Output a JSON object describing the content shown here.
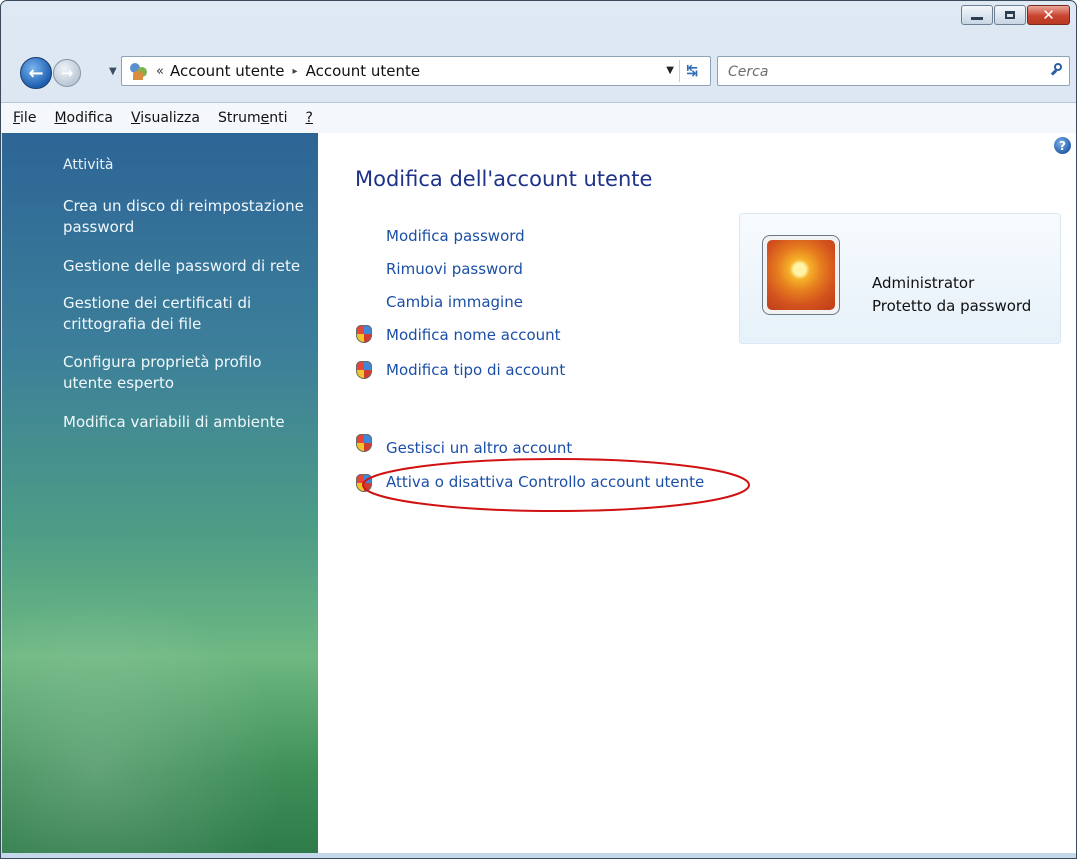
{
  "window": {
    "caption_buttons": {
      "minimize": "minimize-icon",
      "maximize": "maximize-icon",
      "close": "close-icon"
    }
  },
  "navigation": {
    "back_icon": "back-arrow-icon",
    "forward_icon": "forward-arrow-icon",
    "history_icon": "chevron-down-icon"
  },
  "addressbar": {
    "overflow": "«",
    "crumb1": "Account utente",
    "separator": "▸",
    "crumb2": "Account utente",
    "dropdown": "▼",
    "refresh": "↹"
  },
  "search": {
    "placeholder": "Cerca"
  },
  "menubar": {
    "items": [
      {
        "label": "File",
        "accel_index": 0
      },
      {
        "label": "Modifica",
        "accel_index": 0
      },
      {
        "label": "Visualizza",
        "accel_index": 0
      },
      {
        "label": "Strumenti",
        "accel_index": 5
      },
      {
        "label": "?",
        "accel_index": 0
      }
    ]
  },
  "sidebar": {
    "heading": "Attività",
    "items": [
      {
        "label": "Crea un disco di reimpostazione password"
      },
      {
        "label": "Gestione delle password di rete"
      },
      {
        "label": "Gestione dei certificati di crittografia dei file"
      },
      {
        "label": "Configura proprietà profilo utente esperto"
      },
      {
        "label": "Modifica variabili di ambiente"
      }
    ]
  },
  "main": {
    "help": "?",
    "title": "Modifica dell'account utente",
    "tasks": [
      {
        "label": "Modifica password",
        "shield": false
      },
      {
        "label": "Rimuovi password",
        "shield": false
      },
      {
        "label": "Cambia immagine",
        "shield": false
      },
      {
        "label": "Modifica nome account",
        "shield": true
      },
      {
        "label": "Modifica tipo di account",
        "shield": true
      }
    ],
    "other_tasks": [
      {
        "label": "Gestisci un altro account",
        "shield": true
      },
      {
        "label": "Attiva o disattiva Controllo account utente",
        "shield": true,
        "highlighted": true
      }
    ],
    "account": {
      "name": "Administrator",
      "status": "Protetto da password"
    }
  },
  "colors": {
    "link": "#1b4fa6",
    "title": "#1e3287",
    "annotation": "#d01212"
  }
}
